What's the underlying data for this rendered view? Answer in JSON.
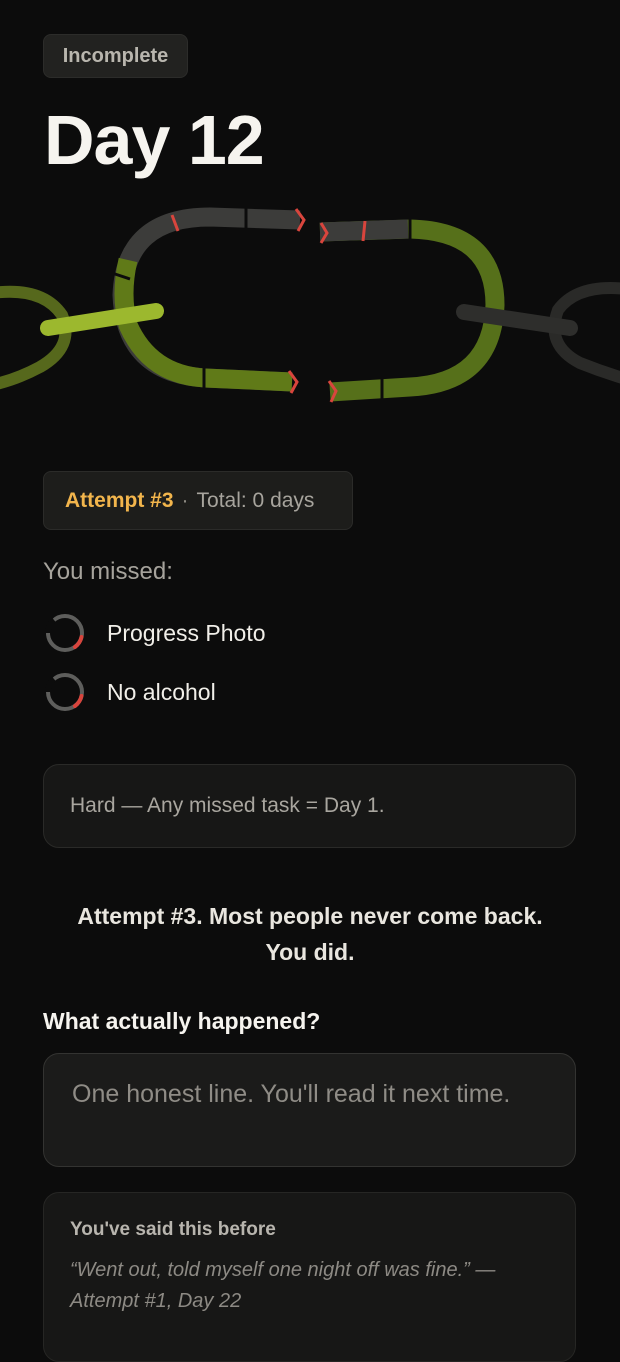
{
  "status_badge": "Incomplete",
  "title": "Day 12",
  "attempt": {
    "label": "Attempt #3",
    "separator": "·",
    "total": "Total: 0 days"
  },
  "missed": {
    "label": "You missed:",
    "tasks": [
      {
        "label": "Progress Photo",
        "icon": "spinner-icon"
      },
      {
        "label": "No alcohol",
        "icon": "spinner-icon"
      }
    ]
  },
  "rule": "Hard — Any missed task = Day 1.",
  "encouragement": {
    "line1": "Attempt #3. Most people never come back.",
    "line2": "You did."
  },
  "question": "What actually happened?",
  "answer": {
    "value": "",
    "placeholder": "One honest line. You'll read it next time."
  },
  "history": {
    "title": "You've said this before",
    "quote": "“Went out, told myself one night off was fine.” — Attempt #1, Day 22"
  },
  "colors": {
    "accent_green": "#7e9a1e",
    "accent_orange": "#f2b54c",
    "break_red": "#d8453d",
    "background": "#0c0c0c"
  }
}
